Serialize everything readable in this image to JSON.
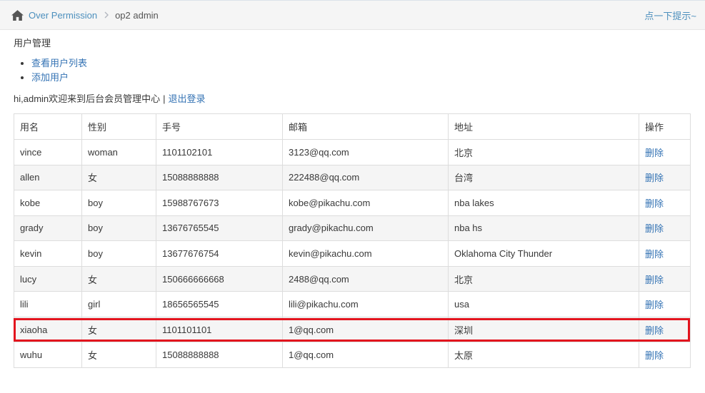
{
  "breadcrumb": {
    "home_icon": "home-icon",
    "separator_icon": "chevron-right-icon",
    "link_label": "Over Permission",
    "current_label": "op2 admin"
  },
  "hint_link": "点一下提示~",
  "section_title": "用户管理",
  "menu": [
    {
      "label": "查看用户列表"
    },
    {
      "label": "添加用户"
    }
  ],
  "welcome": {
    "greeting": "hi,admin欢迎来到后台会员管理中心",
    "separator": "|",
    "logout_label": "退出登录"
  },
  "users_table": {
    "columns": [
      "用名",
      "性别",
      "手号",
      "邮箱",
      "地址",
      "操作"
    ],
    "rows": [
      {
        "name": "vince",
        "gender": "woman",
        "phone": "1101102101",
        "email": "3123@qq.com",
        "address": "北京",
        "action": "删除"
      },
      {
        "name": "allen",
        "gender": "女",
        "phone": "15088888888",
        "email": "222488@qq.com",
        "address": "台湾",
        "action": "删除"
      },
      {
        "name": "kobe",
        "gender": "boy",
        "phone": "15988767673",
        "email": "kobe@pikachu.com",
        "address": "nba lakes",
        "action": "删除"
      },
      {
        "name": "grady",
        "gender": "boy",
        "phone": "13676765545",
        "email": "grady@pikachu.com",
        "address": "nba hs",
        "action": "删除"
      },
      {
        "name": "kevin",
        "gender": "boy",
        "phone": "13677676754",
        "email": "kevin@pikachu.com",
        "address": "Oklahoma City Thunder",
        "action": "删除"
      },
      {
        "name": "lucy",
        "gender": "女",
        "phone": "150666666668",
        "email": "2488@qq.com",
        "address": "北京",
        "action": "删除"
      },
      {
        "name": "lili",
        "gender": "girl",
        "phone": "18656565545",
        "email": "lili@pikachu.com",
        "address": "usa",
        "action": "删除"
      },
      {
        "name": "xiaoha",
        "gender": "女",
        "phone": "1101101101",
        "email": "1@qq.com",
        "address": "深圳",
        "action": "删除"
      },
      {
        "name": "wuhu",
        "gender": "女",
        "phone": "15088888888",
        "email": "1@qq.com",
        "address": "太原",
        "action": "删除"
      }
    ],
    "highlighted_row_index": 7
  },
  "colors": {
    "link": "#3473b4",
    "breadcrumb_link": "#4c8fbd",
    "highlight_border": "#e3141e",
    "row_stripe": "#f5f5f5"
  }
}
